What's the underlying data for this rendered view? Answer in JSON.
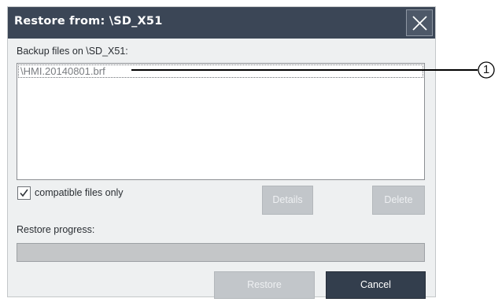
{
  "dialog": {
    "title": "Restore from: \\SD_X51",
    "close_icon": "close-icon"
  },
  "backup": {
    "label": "Backup files on \\SD_X51:",
    "files": [
      "\\HMI.20140801.brf"
    ]
  },
  "options": {
    "compatible_label": "compatible files only",
    "compatible_checked": true
  },
  "buttons": {
    "details": "Details",
    "delete": "Delete",
    "restore": "Restore",
    "cancel": "Cancel"
  },
  "progress": {
    "label": "Restore progress:",
    "fraction": 0
  },
  "callout": {
    "number": "1"
  },
  "colors": {
    "titlebar": "#3b4656",
    "dark_button": "#333e4d",
    "disabled_button": "#c2c6ca"
  }
}
